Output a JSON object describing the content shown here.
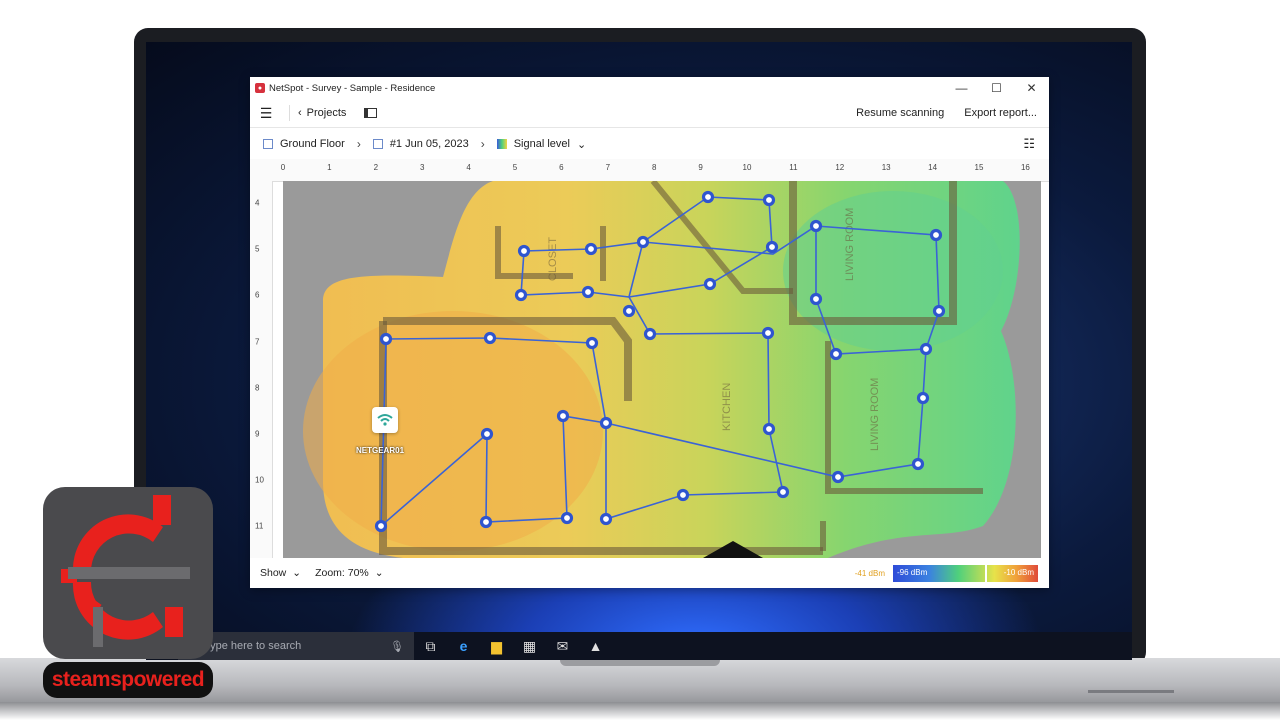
{
  "window": {
    "title": "NetSpot - Survey - Sample - Residence",
    "min_label": "—",
    "max_label": "☐",
    "close_label": "✕"
  },
  "toolbar": {
    "projects_label": "Projects",
    "resume_label": "Resume scanning",
    "export_label": "Export report..."
  },
  "breadcrumb": {
    "floor": "Ground Floor",
    "survey": "#1 Jun 05, 2023",
    "view": "Signal level"
  },
  "ruler": {
    "top": [
      "0",
      "1",
      "2",
      "3",
      "4",
      "5",
      "6",
      "7",
      "8",
      "9",
      "10",
      "11",
      "12",
      "13",
      "14",
      "15",
      "16"
    ],
    "left": [
      "4",
      "5",
      "6",
      "7",
      "8",
      "9",
      "10",
      "11"
    ]
  },
  "map": {
    "access_point_label": "NETGEAR01",
    "room_labels": [
      "CLOSET",
      "KITCHEN",
      "LIVING ROOM",
      "LIVING ROOM"
    ]
  },
  "bottombar": {
    "show_label": "Show",
    "zoom_label": "Zoom: 70%"
  },
  "legend": {
    "current": "-41 dBm",
    "min": "-96 dBm",
    "max": "-10 dBm",
    "colors": [
      "#2e4bd8",
      "#4fd07c",
      "#e7e24a",
      "#e04b3a"
    ]
  },
  "taskbar": {
    "search_placeholder": "Type here to search"
  },
  "watermark": {
    "text": "steamspowered"
  }
}
